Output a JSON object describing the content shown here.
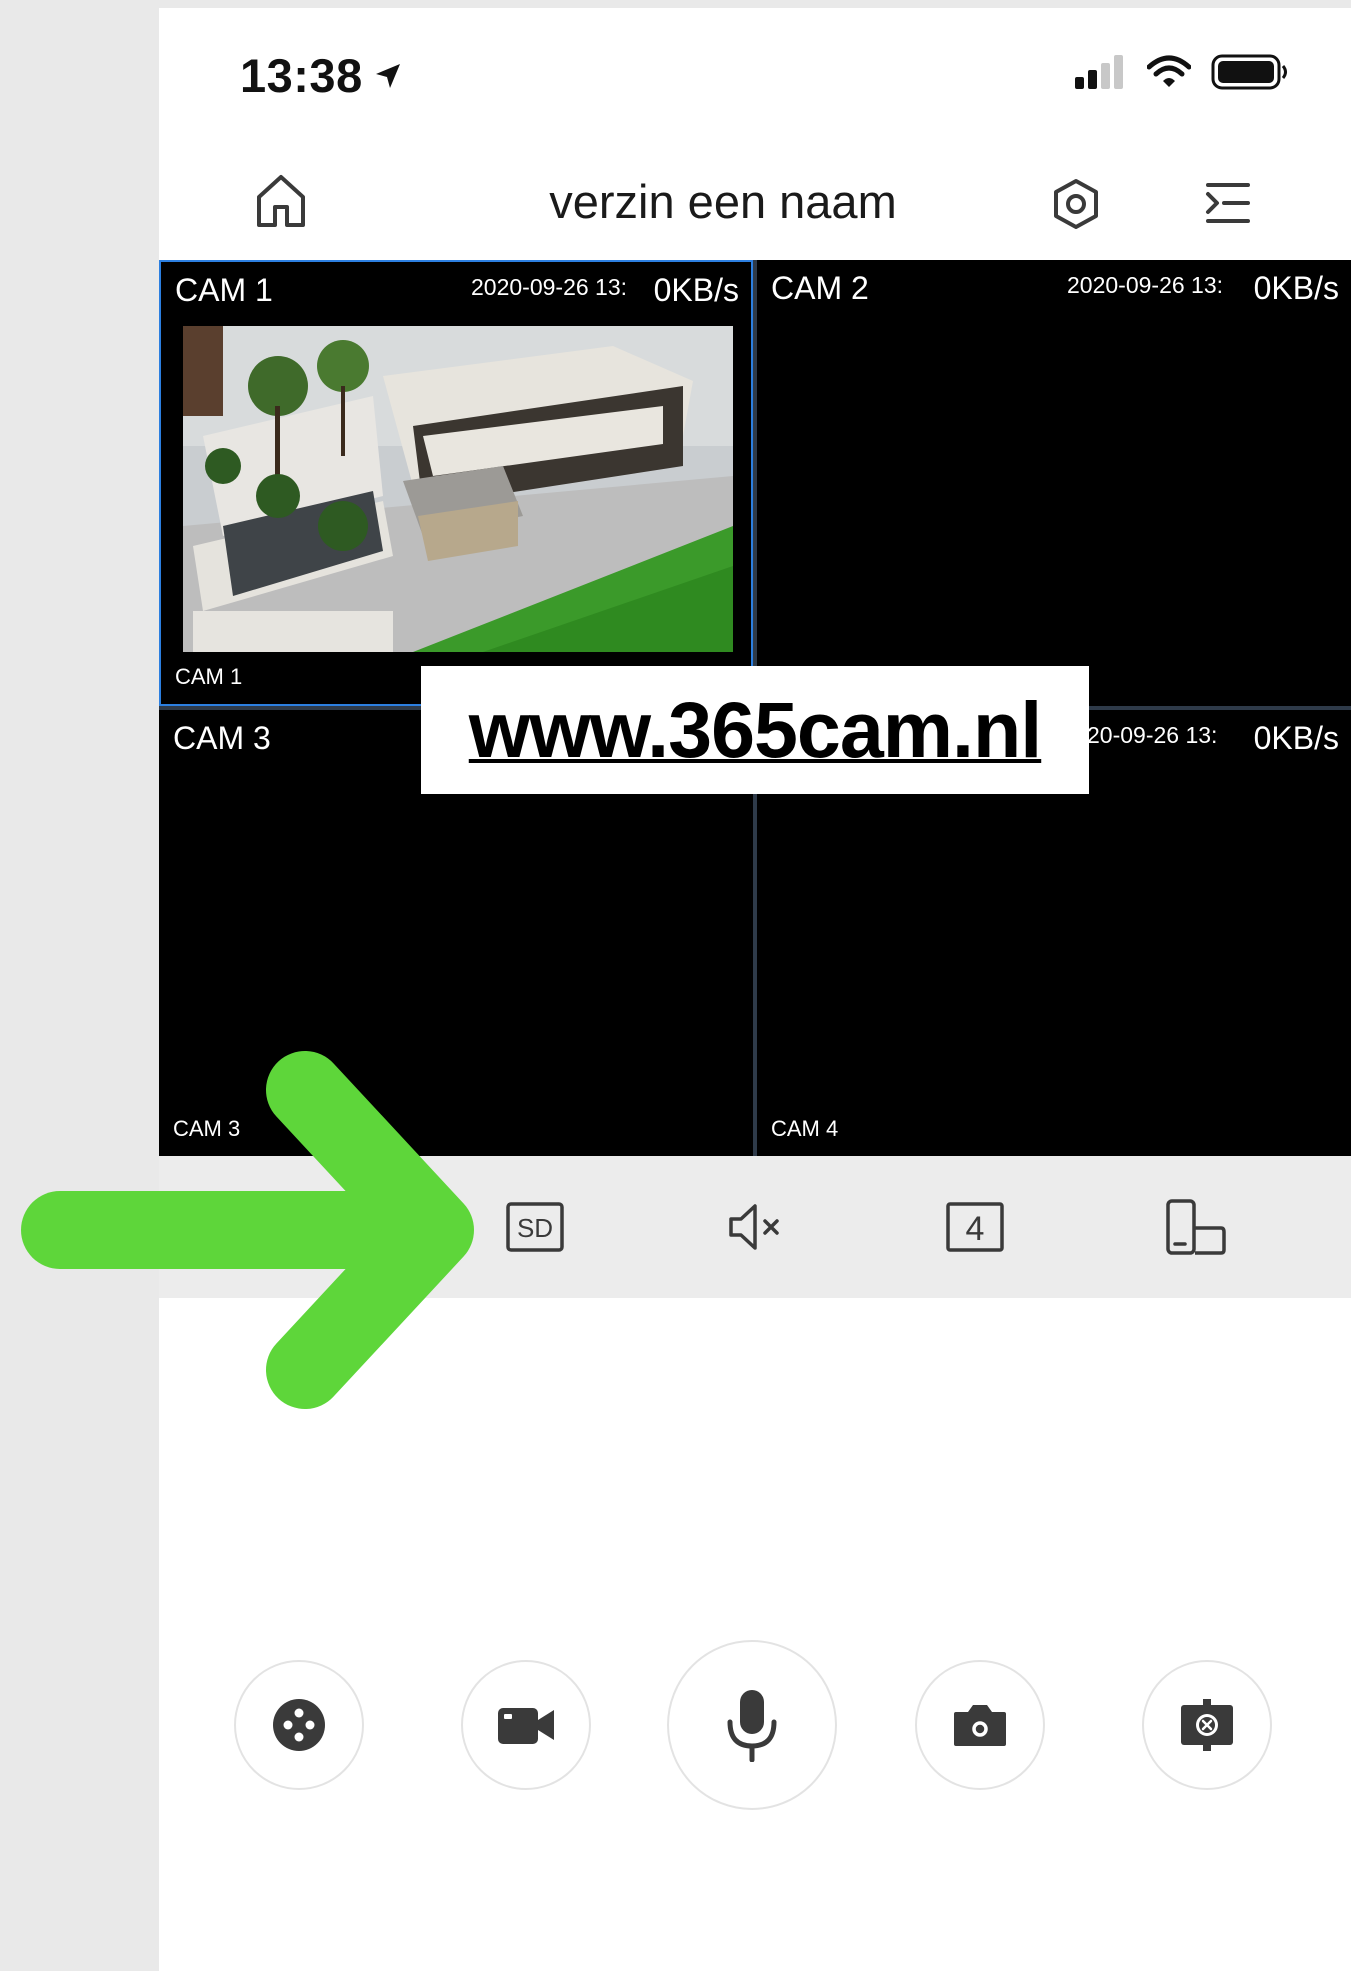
{
  "status_bar": {
    "time": "13:38"
  },
  "header": {
    "title": "verzin een naam"
  },
  "cameras": [
    {
      "title": "CAM 1",
      "date": "2020-09-26 13:",
      "rate": "0KB/s",
      "footer": "CAM 1"
    },
    {
      "title": "CAM 2",
      "date": "2020-09-26 13:",
      "rate": "0KB/s",
      "footer": ""
    },
    {
      "title": "CAM 3",
      "date": "",
      "rate": "",
      "footer": "CAM 3"
    },
    {
      "title": "",
      "date": "20-09-26 13:",
      "rate": "0KB/s",
      "footer": "CAM 4"
    }
  ],
  "watermark": {
    "text": "www.365cam.nl"
  },
  "toolbar": {
    "quality_label": "SD",
    "layout_label": "4"
  },
  "colors": {
    "accent_blue": "#2c7fe0",
    "arrow_green": "#5ed63a",
    "grid_border": "#2e3a49"
  },
  "icons": {
    "header": [
      "home-icon",
      "settings-icon",
      "menu-icon"
    ],
    "toolbar": [
      "sd-quality-icon",
      "mute-icon",
      "split-4-icon",
      "rotate-device-icon"
    ],
    "controls": [
      "ptz-icon",
      "record-icon",
      "microphone-icon",
      "snapshot-icon",
      "focus-icon"
    ]
  }
}
